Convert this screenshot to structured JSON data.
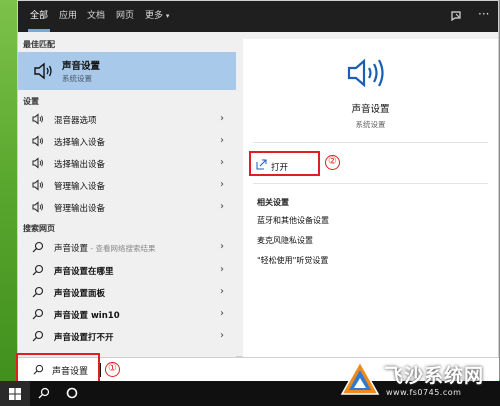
{
  "top_tabs": [
    "全部",
    "应用",
    "文档",
    "网页",
    "更多"
  ],
  "left": {
    "best_match_heading": "最佳匹配",
    "best_match": {
      "title": "声音设置",
      "subtitle": "系统设置"
    },
    "settings_heading": "设置",
    "settings_items": [
      "混音器选项",
      "选择输入设备",
      "选择输出设备",
      "管理输入设备",
      "管理输出设备"
    ],
    "web_heading": "搜索网页",
    "web_items": [
      {
        "label": "声音设置",
        "hint": " - 查看网络搜索结果"
      },
      {
        "label": "声音设置在哪里"
      },
      {
        "label": "声音设置面板"
      },
      {
        "label": "声音设置 win10"
      },
      {
        "label": "声音设置打不开"
      }
    ]
  },
  "right": {
    "title": "声音设置",
    "subtitle": "系统设置",
    "open_label": "打开",
    "related_heading": "相关设置",
    "related_links": [
      "蓝牙和其他设备设置",
      "麦克风隐私设置",
      "\"轻松使用\"听觉设置"
    ]
  },
  "search": {
    "value": "声音设置"
  },
  "annotations": [
    "①",
    "②"
  ],
  "watermark": {
    "text": "飞沙系统网",
    "url": "www.fs0745.com"
  },
  "icons": {
    "speaker": "speaker-icon",
    "search": "search-icon",
    "open": "open-window-icon",
    "chevron": "chevron-right-icon",
    "windows": "windows-logo-icon"
  },
  "colors": {
    "accent_selected": "#a8c9ea",
    "topbar": "#1f1f1f",
    "annotation": "#e02020"
  }
}
